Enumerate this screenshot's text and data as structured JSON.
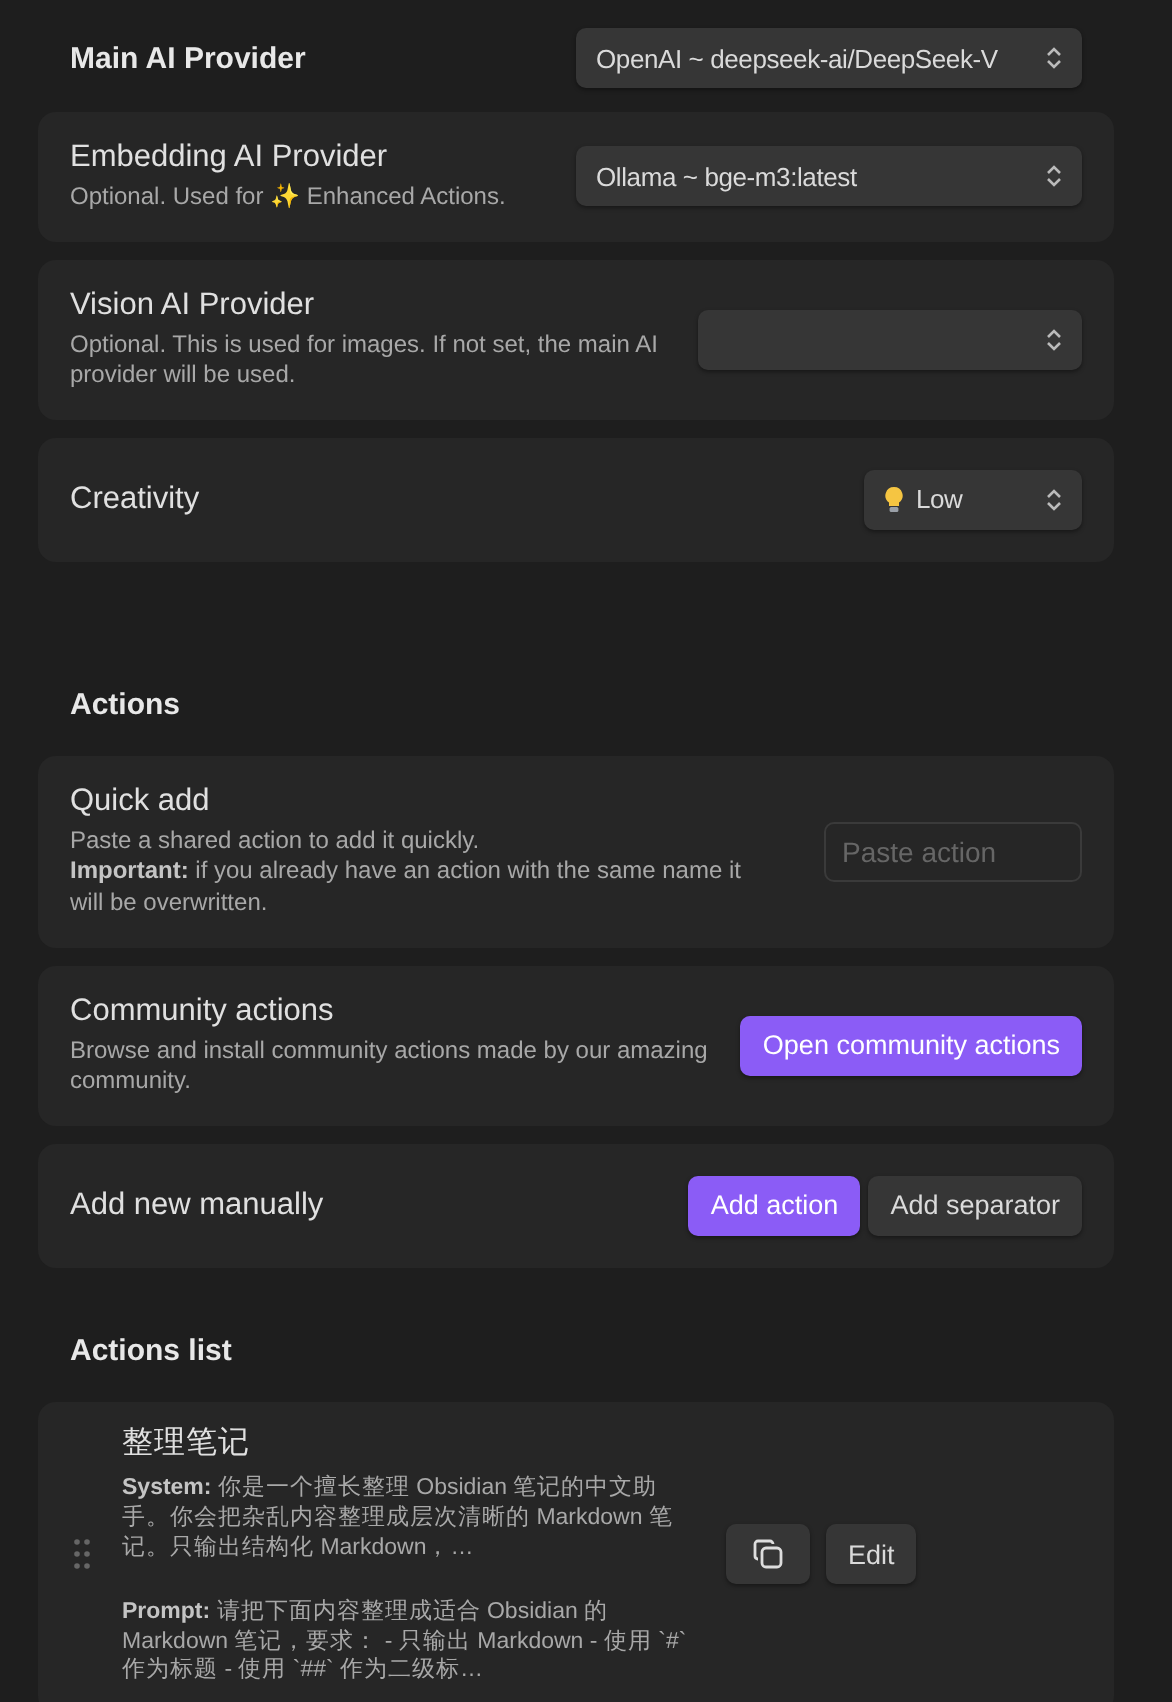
{
  "main_provider": {
    "label": "Main AI Provider",
    "value": "OpenAI ~ deepseek-ai/DeepSeek-V"
  },
  "provider_settings": [
    {
      "kind": "select",
      "label": "Embedding AI Provider",
      "description": "Optional. Used for ✨ Enhanced Actions.",
      "value": "Ollama ~ bge-m3:latest"
    },
    {
      "kind": "select",
      "label": "Vision AI Provider",
      "description": "Optional. This is used for images. If not set, the main AI provider will be used."
    },
    {
      "kind": "bulb_select",
      "label": "Creativity",
      "value": "Low"
    }
  ],
  "actions_heading": "Actions",
  "action_settings": [
    {
      "kind": "input",
      "label": "Quick add",
      "description": [
        "Paste a shared action to add it quickly.",
        "**Important:** if you already have an action with the same name it will be overwritten."
      ],
      "placeholder": "Paste action"
    },
    {
      "kind": "buttons",
      "label": "Community actions",
      "description": [
        "Browse and install community actions made by our amazing community."
      ],
      "buttons": [
        {
          "label": "Open community actions",
          "primary": true
        }
      ]
    },
    {
      "kind": "buttons",
      "label": "Add new manually",
      "buttons": [
        {
          "label": "Add action",
          "primary": true
        },
        {
          "label": "Add separator",
          "primary": false
        }
      ]
    }
  ],
  "actions_list_heading": "Actions list",
  "actions": [
    {
      "name": "整理笔记",
      "system": "**System:** 你是一个擅长整理 Obsidian 笔记的中文助手。你会把杂乱内容整理成层次清晰的 Markdown 笔记。只输出结构化 Markdown，…",
      "prompt": "**Prompt:** 请把下面内容整理成适合 Obsidian 的 Markdown 笔记，要求：  - 只输出 Markdown - 使用 `#` 作为标题 - 使用 `##` 作为二级标…",
      "edit_label": "Edit"
    }
  ]
}
